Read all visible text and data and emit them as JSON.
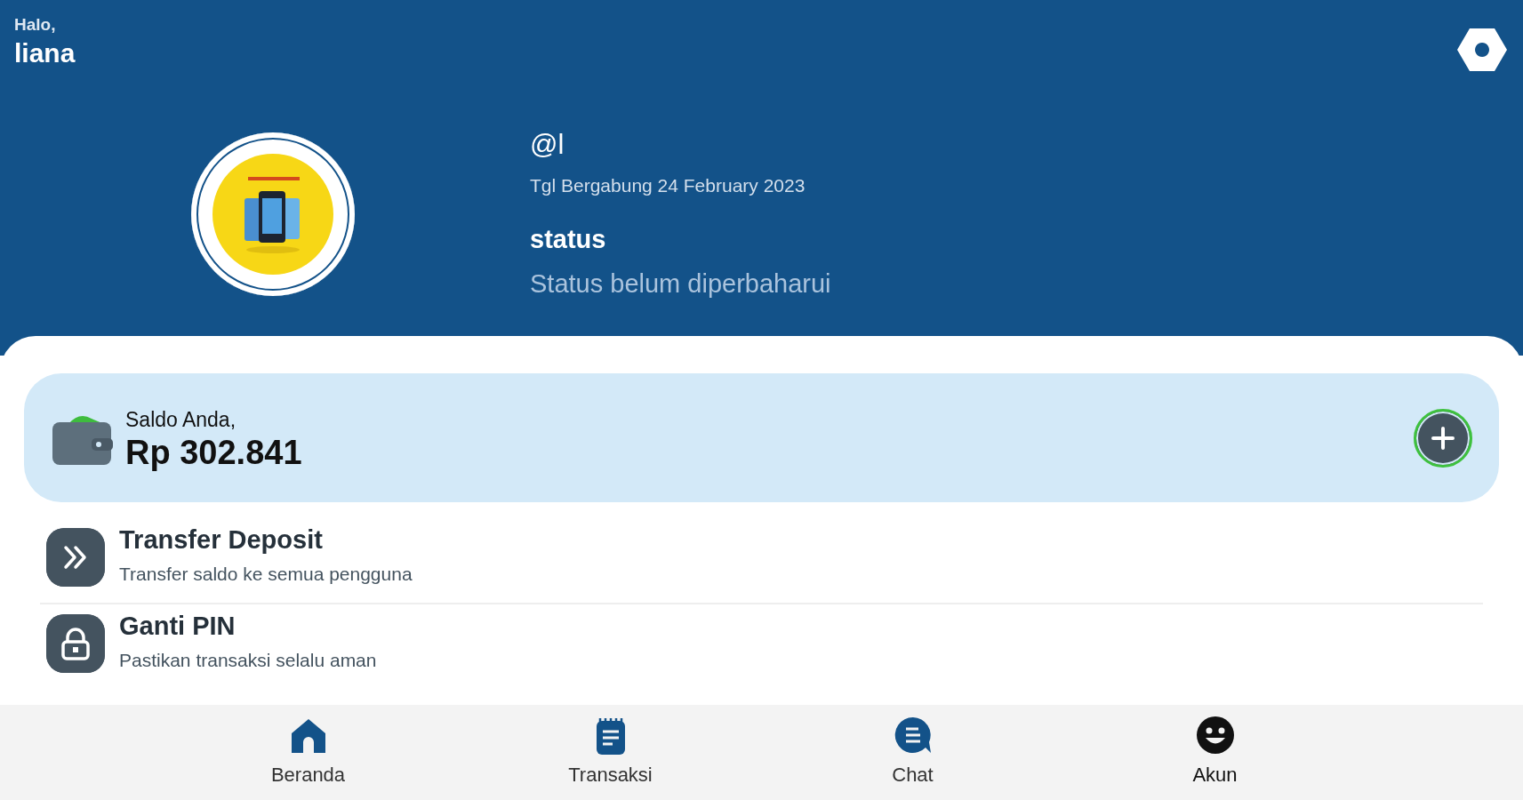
{
  "greeting": {
    "hello": "Halo,",
    "name": "liana"
  },
  "profile": {
    "handle": "@l",
    "joined": "Tgl Bergabung 24 February 2023",
    "status_label": "status",
    "status_text": "Status belum diperbaharui"
  },
  "balance": {
    "label": "Saldo Anda,",
    "amount": "Rp 302.841"
  },
  "menu": [
    {
      "kind": "transfer",
      "title": "Transfer Deposit",
      "subtitle": "Transfer saldo ke semua pengguna"
    },
    {
      "kind": "lock",
      "title": "Ganti PIN",
      "subtitle": "Pastikan transaksi selalu aman"
    }
  ],
  "bottom_nav": [
    {
      "kind": "home",
      "label": "Beranda",
      "selected": false
    },
    {
      "kind": "notes",
      "label": "Transaksi",
      "selected": false
    },
    {
      "kind": "chat",
      "label": "Chat",
      "selected": false
    },
    {
      "kind": "face",
      "label": "Akun",
      "selected": true
    }
  ]
}
